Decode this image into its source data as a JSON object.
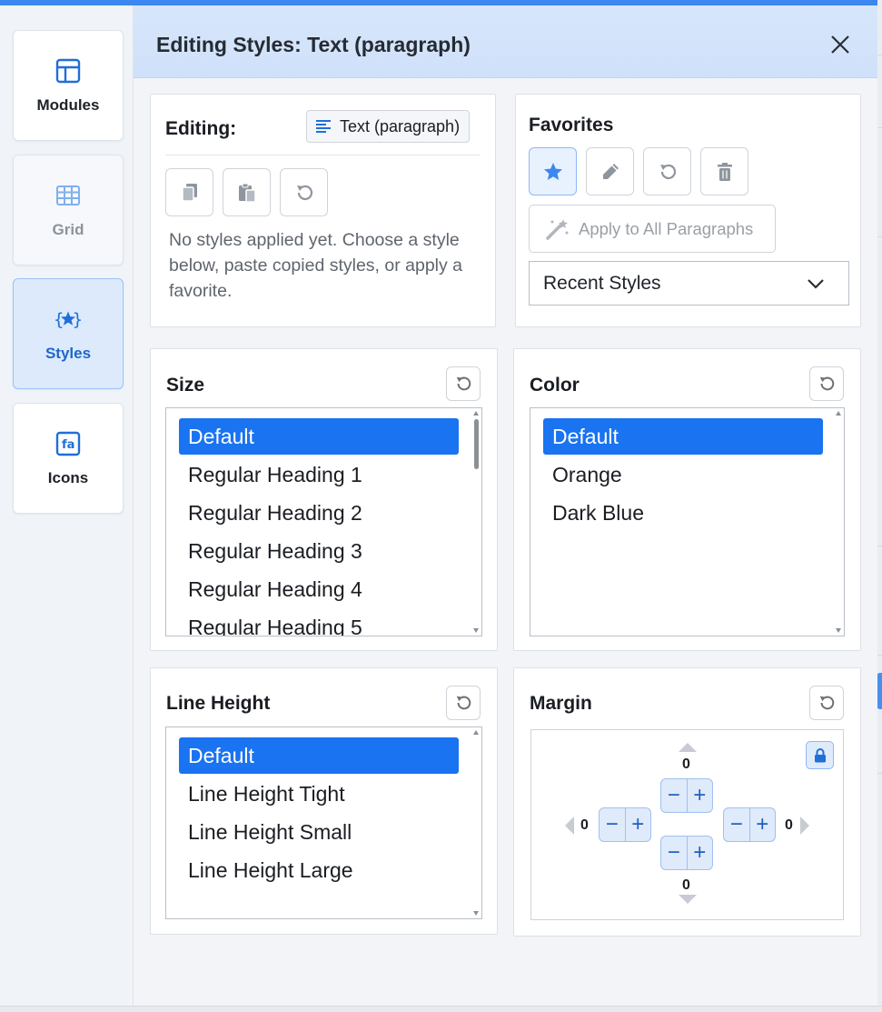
{
  "window": {
    "title": "Editing Styles: Text (paragraph)"
  },
  "nav": {
    "items": [
      {
        "label": "Modules",
        "icon": "layout-icon",
        "state": "normal"
      },
      {
        "label": "Grid",
        "icon": "grid-icon",
        "state": "disabled"
      },
      {
        "label": "Styles",
        "icon": "braces-star-icon",
        "state": "active"
      },
      {
        "label": "Icons",
        "icon": "font-awesome-icon",
        "state": "normal"
      }
    ]
  },
  "editing": {
    "label": "Editing:",
    "target_label": "Text (paragraph)",
    "message": "No styles applied yet. Choose a style below, paste copied styles, or apply a favorite."
  },
  "favorites": {
    "title": "Favorites",
    "apply_all_label": "Apply to All Paragraphs",
    "recent_selected": "Recent Styles"
  },
  "size": {
    "title": "Size",
    "options": [
      "Default",
      "Regular Heading 1",
      "Regular Heading 2",
      "Regular Heading 3",
      "Regular Heading 4",
      "Regular Heading 5"
    ],
    "selected": "Default"
  },
  "color": {
    "title": "Color",
    "options": [
      "Default",
      "Orange",
      "Dark Blue"
    ],
    "selected": "Default"
  },
  "line_height": {
    "title": "Line Height",
    "options": [
      "Default",
      "Line Height Tight",
      "Line Height Small",
      "Line Height Large"
    ],
    "selected": "Default"
  },
  "margin": {
    "title": "Margin",
    "top": "0",
    "bottom": "0",
    "left": "0",
    "right": "0"
  },
  "colors": {
    "accent": "#1a73f0",
    "header_bg": "#d7e6fa",
    "top_bar": "#3d87f0"
  }
}
